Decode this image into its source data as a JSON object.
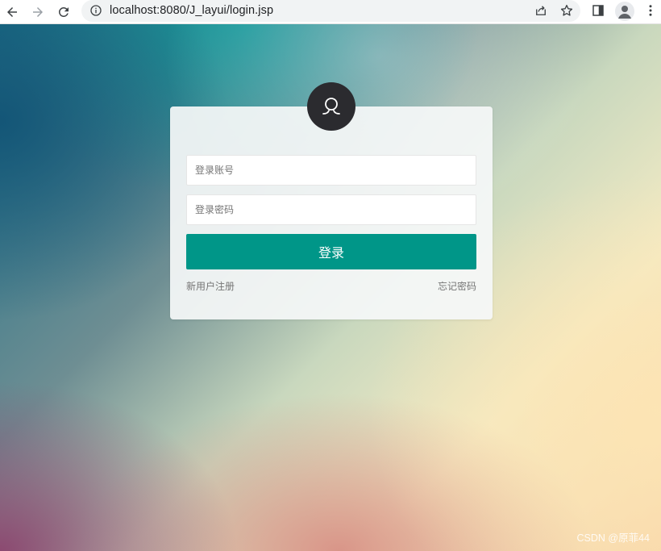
{
  "browser": {
    "url": "localhost:8080/J_layui/login.jsp",
    "icons": [
      "back-arrow-icon",
      "forward-arrow-icon",
      "reload-icon",
      "info-icon",
      "share-icon",
      "star-icon",
      "side-panel-icon",
      "profile-icon",
      "kebab-menu-icon"
    ]
  },
  "login": {
    "avatar_icon": "user-avatar-icon",
    "username_placeholder": "登录账号",
    "password_placeholder": "登录密码",
    "submit_label": "登录",
    "register_link": "新用户注册",
    "forgot_link": "忘记密码"
  },
  "watermark": "CSDN @原菲44",
  "colors": {
    "primary": "#009688",
    "avatar_bg": "#2b2b2f"
  }
}
